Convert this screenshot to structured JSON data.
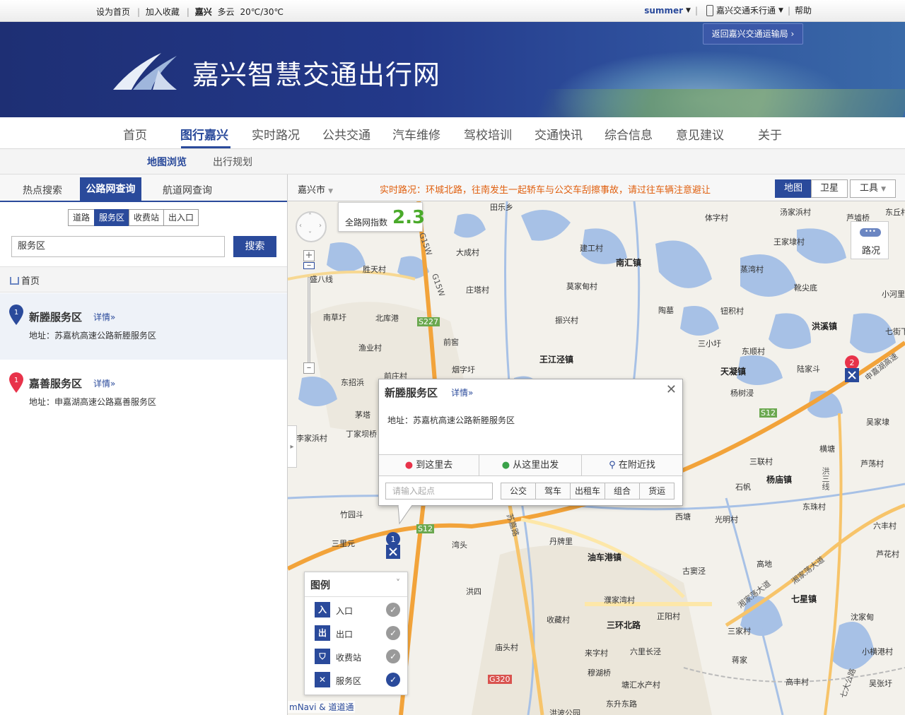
{
  "topbar": {
    "set_home": "设为首页",
    "add_fav": "加入收藏",
    "city": "嘉兴",
    "weather": "多云",
    "temp": "20℃/30℃",
    "user": "summer",
    "app": "嘉兴交通禾行通",
    "help": "帮助"
  },
  "banner": {
    "title": "嘉兴智慧交通出行网",
    "back": "返回嘉兴交通运输局"
  },
  "nav": {
    "items": [
      "首页",
      "图行嘉兴",
      "实时路况",
      "公共交通",
      "汽车维修",
      "驾校培训",
      "交通快讯",
      "综合信息",
      "意见建议",
      "关于"
    ]
  },
  "subnav": {
    "items": [
      "地图浏览",
      "出行规划"
    ]
  },
  "left": {
    "tabs": [
      "热点搜索",
      "公路网查询",
      "航道网查询"
    ],
    "seg": [
      "道路",
      "服务区",
      "收费站",
      "出入口"
    ],
    "search_value": "服务区",
    "search_btn": "搜索",
    "crumb": "首页",
    "results": [
      {
        "num": "1",
        "name": "新塍服务区",
        "detail": "详情»",
        "addr": "地址：苏嘉杭高速公路新塍服务区",
        "color": "#2a4a9b"
      },
      {
        "num": "1",
        "name": "嘉善服务区",
        "detail": "详情»",
        "addr": "地址：申嘉湖高速公路嘉善服务区",
        "color": "#e8334a"
      }
    ]
  },
  "map": {
    "city": "嘉兴市",
    "news": "实时路况：环城北路，往南发生一起轿车与公交车刮擦事故，请过往车辆注意避让",
    "toggles": [
      "地图",
      "卫星",
      "工具"
    ],
    "index_label": "全路网指数",
    "index_value": "2.3",
    "traffic_btn": "路况",
    "popup": {
      "title": "新塍服务区",
      "detail": "详情»",
      "close": "✕",
      "addr": "地址：苏嘉杭高速公路新塍服务区",
      "actions": [
        "到这里去",
        "从这里出发",
        "在附近找"
      ],
      "placeholder": "请输入起点",
      "modes": [
        "公交",
        "驾车",
        "出租车",
        "组合",
        "货运"
      ]
    },
    "legend": {
      "title": "图例",
      "items": [
        {
          "icon": "入",
          "label": "入口",
          "on": false
        },
        {
          "icon": "出",
          "label": "出口",
          "on": false
        },
        {
          "icon": "⛉",
          "label": "收费站",
          "on": false
        },
        {
          "icon": "✕",
          "label": "服务区",
          "on": true
        }
      ]
    },
    "copyright": "mNavi & 道道通",
    "marker1": "1",
    "marker2": "2",
    "places": [
      "田乐乡",
      "大成村",
      "胜天村",
      "建工村",
      "南汇镇",
      "庄塔村",
      "盛八线",
      "南草圩",
      "北库港",
      "莫家甸村",
      "陶墓",
      "钮积村",
      "振兴村",
      "王江泾镇",
      "前窖",
      "渔业村",
      "东招浜",
      "前庄村",
      "烟字圩",
      "茅塔",
      "丁家坝桥",
      "李家浜村",
      "竹园斗",
      "三里元",
      "湾头",
      "洪四",
      "丹牌里",
      "油车港镇",
      "濮家湾村",
      "三环北路",
      "收藏村",
      "庙头村",
      "来字村",
      "穆湖桥",
      "六里长泾",
      "塘汇水产村",
      "东升东路",
      "洪波公园",
      "正阳村",
      "古窦泾",
      "高地",
      "七星镇",
      "三家村",
      "蒋家",
      "高丰村",
      "沈家甸",
      "小横港村",
      "吴张圩",
      "芦花村",
      "六丰村",
      "东珠村",
      "光明村",
      "西塘",
      "杨庙镇",
      "石帆",
      "三联村",
      "横塘",
      "芦荡村",
      "吴家埭",
      "天凝镇",
      "陆家斗",
      "杨树浸",
      "东顺村",
      "三小圩",
      "洪溪镇",
      "七街下",
      "小河里",
      "靴尖底",
      "蒸湾村",
      "王家埭村",
      "体字村",
      "汤家浜村",
      "芦墟桥",
      "东丘村"
    ],
    "road_labels": [
      "G15W",
      "G15W",
      "S227",
      "S12",
      "S12",
      "G320",
      "苏嘉路",
      "湘家荡大道",
      "湘家荡大道",
      "洪三线",
      "七大公路",
      "申嘉湖高速"
    ]
  }
}
